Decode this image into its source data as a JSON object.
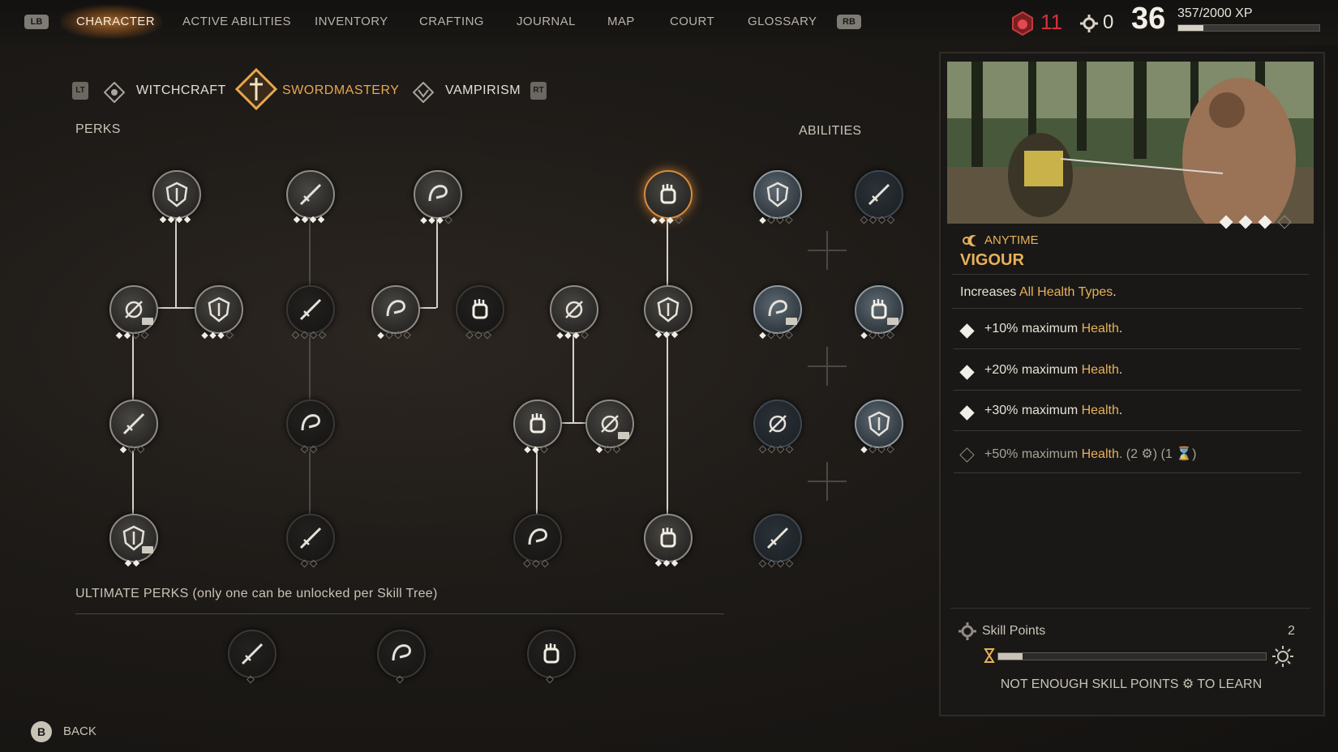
{
  "top_nav": {
    "left_bumper": "LB",
    "right_bumper": "RB",
    "tabs": [
      "CHARACTER",
      "ACTIVE ABILITIES",
      "INVENTORY",
      "CRAFTING",
      "JOURNAL",
      "MAP",
      "COURT",
      "GLOSSARY"
    ],
    "active_tab": "CHARACTER"
  },
  "stats": {
    "blood_count": "11",
    "skill_points_count": "0",
    "level": "36",
    "xp": "357/2000 XP",
    "xp_fraction": 0.1785
  },
  "skill_trees": {
    "left_trigger": "LT",
    "right_trigger": "RT",
    "tabs": [
      "WITCHCRAFT",
      "SWORDMASTERY",
      "VAMPIRISM"
    ],
    "active": "SWORDMASTERY"
  },
  "sections": {
    "perks": "PERKS",
    "abilities": "ABILITIES",
    "ultimate": "ULTIMATE PERKS (only one can be unlocked per Skill Tree)"
  },
  "perk_ranks": [
    {
      "icon": "shield-icon",
      "filled": 4,
      "total": 4
    },
    {
      "icon": "sword-slash-icon",
      "filled": 4,
      "total": 4
    },
    {
      "icon": "flexed-arm-icon",
      "filled": 3,
      "total": 4
    },
    {
      "icon": "fist-icon",
      "filled": 3,
      "total": 4,
      "selected": true
    },
    {
      "icon": "blade-drip-icon",
      "filled": 2,
      "total": 4,
      "book": true
    },
    {
      "icon": "crossed-swords-icon",
      "filled": 3,
      "total": 4
    },
    {
      "icon": "spiked-sword-icon",
      "filled": 0,
      "total": 4
    },
    {
      "icon": "clawed-hand-icon",
      "filled": 1,
      "total": 4
    },
    {
      "icon": "mounted-knight-icon",
      "filled": 0,
      "total": 3
    },
    {
      "icon": "burst-icon",
      "filled": 3,
      "total": 4
    },
    {
      "icon": "armor-figure-icon",
      "filled": 3,
      "total": 3
    },
    {
      "icon": "sword-arc-icon",
      "filled": 1,
      "total": 3
    },
    {
      "icon": "dark-slash-icon",
      "filled": 0,
      "total": 2
    },
    {
      "icon": "upright-sword-icon",
      "filled": 2,
      "total": 3
    },
    {
      "icon": "target-burst-icon",
      "filled": 1,
      "total": 3,
      "book": true
    },
    {
      "icon": "target-icon",
      "filled": 2,
      "total": 2,
      "book": true
    },
    {
      "icon": "triple-blade-icon",
      "filled": 0,
      "total": 2
    },
    {
      "icon": "lunge-icon",
      "filled": 0,
      "total": 3
    },
    {
      "icon": "plate-armor-icon",
      "filled": 3,
      "total": 3
    }
  ],
  "ability_ranks": [
    {
      "icon": "wing-slash-icon",
      "filled": 1,
      "total": 4
    },
    {
      "icon": "serpent-icon",
      "filled": 0,
      "total": 4
    },
    {
      "icon": "leaping-strike-icon",
      "filled": 1,
      "total": 4,
      "book": true
    },
    {
      "icon": "helmet-head-icon",
      "filled": 1,
      "total": 4,
      "book": true
    },
    {
      "icon": "swirl-icon",
      "filled": 0,
      "total": 4
    },
    {
      "icon": "sword-coil-icon",
      "filled": 1,
      "total": 4
    },
    {
      "icon": "cloak-icon",
      "filled": 0,
      "total": 4
    }
  ],
  "ultimate_perks": [
    {
      "icon": "raised-fist-icon",
      "filled": 0,
      "total": 1
    },
    {
      "icon": "boot-blade-icon",
      "filled": 0,
      "total": 1
    },
    {
      "icon": "crossed-blade-icon",
      "filled": 0,
      "total": 1
    }
  ],
  "detail": {
    "rank_filled": 3,
    "rank_total": 4,
    "timing": "ANYTIME",
    "title": "VIGOUR",
    "description_prefix": "Increases ",
    "description_highlight": "All Health Types",
    "description_suffix": ".",
    "ranks": [
      {
        "text": "+10% maximum ",
        "highlight": "Health",
        "suffix": ".",
        "unlocked": true,
        "cost": ""
      },
      {
        "text": "+20% maximum ",
        "highlight": "Health",
        "suffix": ".",
        "unlocked": true,
        "cost": ""
      },
      {
        "text": "+30% maximum ",
        "highlight": "Health",
        "suffix": ".",
        "unlocked": true,
        "cost": ""
      },
      {
        "text": "+50% maximum ",
        "highlight": "Health",
        "suffix": ".",
        "unlocked": false,
        "cost": "(2 ⚙) (1 ⌛)"
      }
    ],
    "skill_points_label": "Skill Points",
    "skill_points_value": "2",
    "notice_pre": "NOT ENOUGH SKILL POINTS",
    "notice_post": "TO LEARN"
  },
  "footer": {
    "button": "B",
    "label": "BACK"
  },
  "colors": {
    "accent": "#e8a74d",
    "blood": "#d2323a",
    "highlight": "#e8b15a",
    "selected_ring": "#d88d3b"
  }
}
